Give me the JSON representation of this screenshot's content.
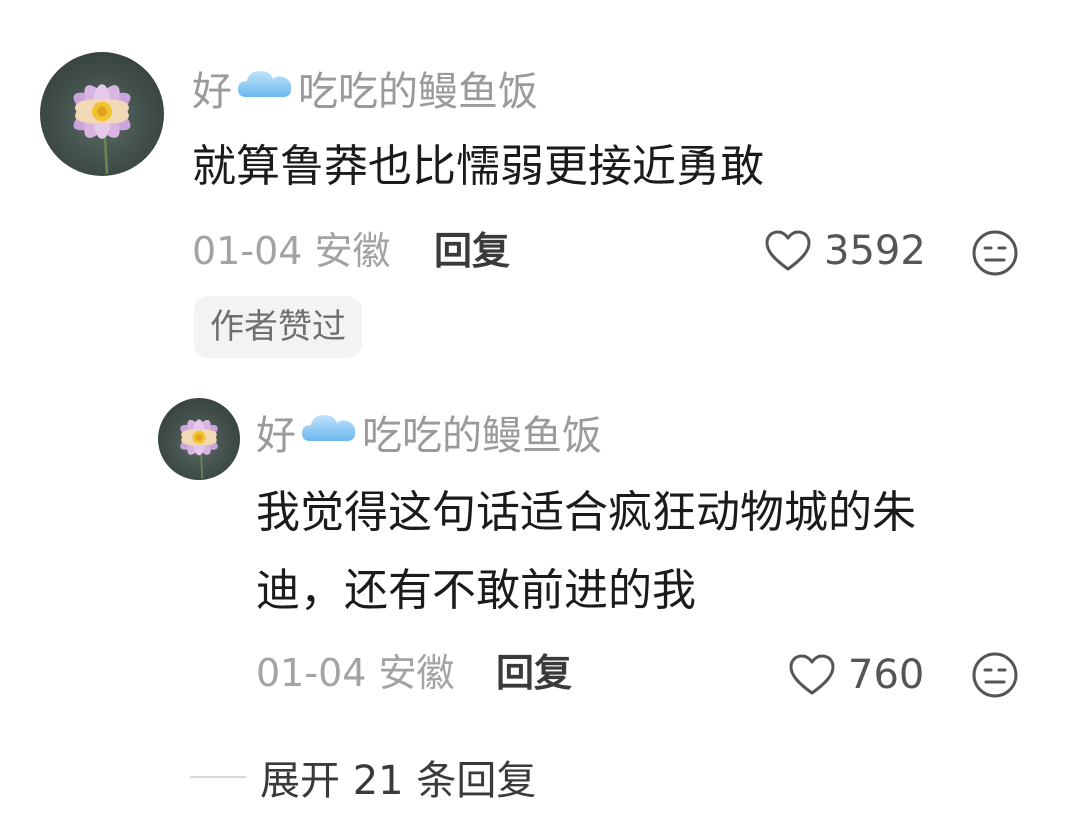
{
  "comment": {
    "username_pre": "好",
    "username_post": "吃吃的鳗鱼饭",
    "text": "就算鲁莽也比懦弱更接近勇敢",
    "date": "01-04",
    "location": "安徽",
    "reply_label": "回复",
    "likes": "3592",
    "badge": "作者赞过"
  },
  "reply_comment": {
    "username_pre": "好",
    "username_post": "吃吃的鳗鱼饭",
    "text_line1": "我觉得这句话适合疯狂动物城的朱",
    "text_line2": "迪，还有不敢前进的我",
    "date": "01-04",
    "location": "安徽",
    "reply_label": "回复",
    "likes": "760"
  },
  "expand_label": "展开 21 条回复",
  "icons": {
    "avatar": "lotus-avatar-icon",
    "cloud": "cloud-emoji-icon",
    "like": "heart-outline-icon",
    "dislike": "meh-face-icon"
  },
  "colors": {
    "username": "#9a9a9a",
    "content": "#1b1b1b",
    "meta": "#a3a3a3",
    "badge_bg": "#f3f3f3"
  }
}
